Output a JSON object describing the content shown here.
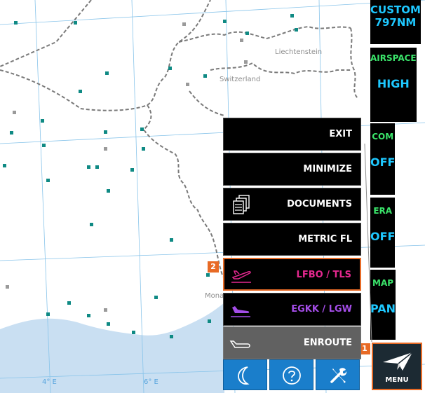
{
  "map": {
    "labels": {
      "liechtenstein": "Liechtenstein",
      "switzerland": "Switzerland",
      "monaco": "Monaco"
    },
    "coords": {
      "lon4": "4° E",
      "lon6": "6° E"
    }
  },
  "sidebar": {
    "custom": {
      "title": "CUSTOM",
      "value": "797NM"
    },
    "airspace": {
      "label": "AIRSPACE",
      "value": "HIGH"
    },
    "com": {
      "label": "COM",
      "value": "OFF"
    },
    "era": {
      "label": "ERA",
      "value": "OFF"
    },
    "map": {
      "label": "MAP",
      "value": "PAN"
    },
    "menu_button": {
      "label": "MENU",
      "icon": "paper-plane-icon",
      "badge": "1"
    }
  },
  "menu": {
    "items": [
      {
        "label": "EXIT"
      },
      {
        "label": "MINIMIZE"
      },
      {
        "label": "DOCUMENTS",
        "icon": "documents-icon"
      },
      {
        "label": "METRIC FL"
      },
      {
        "label": "LFBO / TLS",
        "icon": "takeoff-icon",
        "color": "#e5288f",
        "badge": "2"
      },
      {
        "label": "EGKK / LGW",
        "icon": "landing-icon",
        "color": "#a44de8"
      },
      {
        "label": "ENROUTE",
        "icon": "cruise-icon",
        "color": "#ffffff"
      }
    ],
    "bottom": [
      {
        "icon": "night-mode-icon"
      },
      {
        "icon": "help-icon"
      },
      {
        "icon": "settings-icon"
      }
    ]
  },
  "colors": {
    "accent_orange": "#e86a25",
    "cyan": "#1ec8ff",
    "green": "#3be56b",
    "airport_teal": "#0f8a84",
    "bottom_button_blue": "#1a7ecb"
  }
}
